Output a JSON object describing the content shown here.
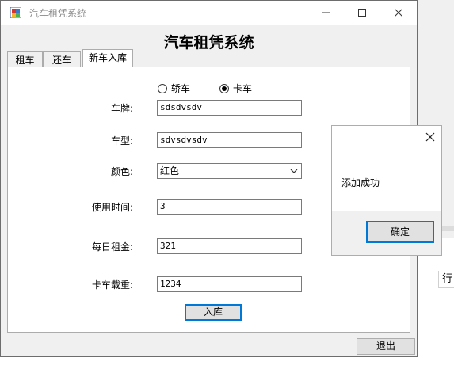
{
  "window": {
    "title": "汽车租凭系统",
    "heading": "汽车租凭系统"
  },
  "tabs": [
    {
      "label": "租车"
    },
    {
      "label": "还车"
    },
    {
      "label": "新车入库"
    }
  ],
  "form": {
    "vehicle_type_options": [
      {
        "label": "轿车",
        "selected": false
      },
      {
        "label": "卡车",
        "selected": true
      }
    ],
    "plate_label": "车牌:",
    "plate_value": "sdsdvsdv",
    "model_label": "车型:",
    "model_value": "sdvsdvsdv",
    "color_label": "颜色:",
    "color_value": "红色",
    "usage_time_label": "使用时间:",
    "usage_time_value": "3",
    "daily_rent_label": "每日租金:",
    "daily_rent_value": "321",
    "load_label": "卡车载重:",
    "load_value": "1234",
    "store_button": "入库"
  },
  "footer": {
    "exit_button": "退出"
  },
  "message_box": {
    "text": "添加成功",
    "ok_button": "确定"
  },
  "background": {
    "column_header": "行"
  },
  "colors": {
    "accent": "#0078d7",
    "window_bg": "#f0f0f0",
    "title_gray": "#8a8a8a"
  }
}
